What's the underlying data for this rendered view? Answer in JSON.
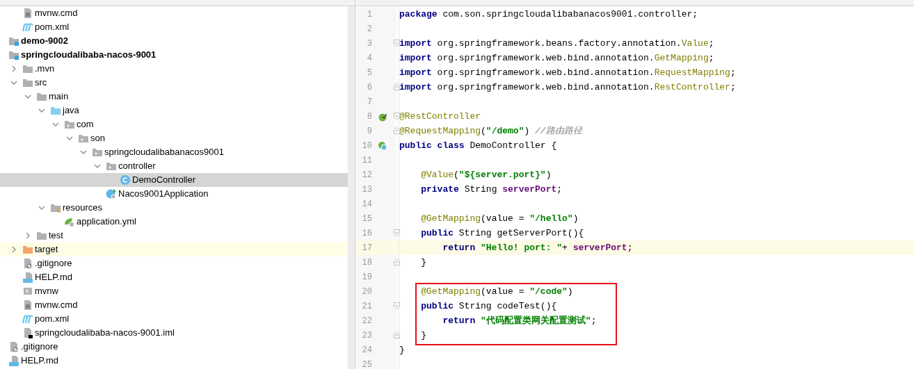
{
  "project_tree": {
    "partial_top": [
      {
        "name": "mvnw.cmd",
        "kind": "text-file"
      },
      {
        "name": "pom.xml",
        "kind": "maven"
      }
    ],
    "items": [
      {
        "name": "demo-9002",
        "kind": "module",
        "bold": true
      },
      {
        "name": "springcloudalibaba-nacos-9001",
        "kind": "module",
        "bold": true,
        "children": [
          {
            "name": ".mvn",
            "kind": "folder",
            "expanded": false
          },
          {
            "name": "src",
            "kind": "folder",
            "expanded": true,
            "children": [
              {
                "name": "main",
                "kind": "folder",
                "expanded": true,
                "children": [
                  {
                    "name": "java",
                    "kind": "source-folder",
                    "expanded": true,
                    "children": [
                      {
                        "name": "com",
                        "kind": "package",
                        "expanded": true,
                        "children": [
                          {
                            "name": "son",
                            "kind": "package",
                            "expanded": true,
                            "children": [
                              {
                                "name": "springcloudalibabanacos9001",
                                "kind": "package",
                                "expanded": true,
                                "children": [
                                  {
                                    "name": "controller",
                                    "kind": "package",
                                    "expanded": true,
                                    "children": [
                                      {
                                        "name": "DemoController",
                                        "kind": "class",
                                        "selected": true
                                      }
                                    ]
                                  },
                                  {
                                    "name": "Nacos9001Application",
                                    "kind": "app-class",
                                    "selected": false
                                  }
                                ]
                              }
                            ]
                          }
                        ]
                      }
                    ]
                  },
                  {
                    "name": "resources",
                    "kind": "resources-folder",
                    "expanded": true,
                    "children": [
                      {
                        "name": "application.yml",
                        "kind": "spring-config"
                      }
                    ]
                  }
                ]
              },
              {
                "name": "test",
                "kind": "folder",
                "expanded": false
              }
            ]
          },
          {
            "name": "target",
            "kind": "excluded-folder",
            "expanded": false,
            "ignored": true
          },
          {
            "name": ".gitignore",
            "kind": "ignore-file"
          },
          {
            "name": "HELP.md",
            "kind": "markdown"
          },
          {
            "name": "mvnw",
            "kind": "script"
          },
          {
            "name": "mvnw.cmd",
            "kind": "text-file"
          },
          {
            "name": "pom.xml",
            "kind": "maven"
          },
          {
            "name": "springcloudalibaba-nacos-9001.iml",
            "kind": "iml"
          }
        ]
      },
      {
        "name": ".gitignore",
        "kind": "ignore-file"
      },
      {
        "name": "HELP.md",
        "kind": "markdown"
      }
    ]
  },
  "editor": {
    "lines": [
      {
        "number": "1",
        "tokens": [
          {
            "kind": "keyword",
            "text": "package"
          },
          {
            "kind": "plain",
            "text": " com.son.springcloudalibabanacos9001.controller;"
          }
        ]
      },
      {
        "number": "2"
      },
      {
        "number": "3",
        "fold": {
          "kind": "open"
        },
        "tokens": [
          {
            "kind": "keyword",
            "text": "import"
          },
          {
            "kind": "plain",
            "text": " org.springframework.beans.factory.annotation."
          },
          {
            "kind": "annotation",
            "text": "Value"
          },
          {
            "kind": "plain",
            "text": ";"
          }
        ]
      },
      {
        "number": "4",
        "tokens": [
          {
            "kind": "keyword",
            "text": "import"
          },
          {
            "kind": "plain",
            "text": " org.springframework.web.bind.annotation."
          },
          {
            "kind": "annotation",
            "text": "GetMapping"
          },
          {
            "kind": "plain",
            "text": ";"
          }
        ]
      },
      {
        "number": "5",
        "tokens": [
          {
            "kind": "keyword",
            "text": "import"
          },
          {
            "kind": "plain",
            "text": " org.springframework.web.bind.annotation."
          },
          {
            "kind": "annotation",
            "text": "RequestMapping"
          },
          {
            "kind": "plain",
            "text": ";"
          }
        ]
      },
      {
        "number": "6",
        "fold": {
          "kind": "close"
        },
        "tokens": [
          {
            "kind": "keyword",
            "text": "import"
          },
          {
            "kind": "plain",
            "text": " org.springframework.web.bind.annotation."
          },
          {
            "kind": "annotation",
            "text": "RestController"
          },
          {
            "kind": "plain",
            "text": ";"
          }
        ]
      },
      {
        "number": "7"
      },
      {
        "number": "8",
        "fold": {
          "kind": "open"
        },
        "gutter": {
          "kind": "bean"
        },
        "tokens": [
          {
            "kind": "annotation",
            "text": "@RestController"
          }
        ]
      },
      {
        "number": "9",
        "fold": {
          "kind": "close"
        },
        "tokens": [
          {
            "kind": "annotation",
            "text": "@RequestMapping"
          },
          {
            "kind": "plain",
            "text": "("
          },
          {
            "kind": "string",
            "text": "\"/demo\""
          },
          {
            "kind": "plain",
            "text": ") "
          },
          {
            "kind": "comment",
            "text": "//路由路径"
          }
        ]
      },
      {
        "number": "10",
        "gutter": {
          "kind": "class"
        },
        "tokens": [
          {
            "kind": "keyword",
            "text": "public class"
          },
          {
            "kind": "plain",
            "text": " DemoController {"
          }
        ]
      },
      {
        "number": "11"
      },
      {
        "number": "12",
        "tokens": [
          {
            "kind": "annotation",
            "text": "    @Value"
          },
          {
            "kind": "plain",
            "text": "("
          },
          {
            "kind": "string",
            "text": "\"${server.port}\""
          },
          {
            "kind": "plain",
            "text": ")"
          }
        ]
      },
      {
        "number": "13",
        "tokens": [
          {
            "kind": "keyword",
            "text": "    private"
          },
          {
            "kind": "plain",
            "text": " String "
          },
          {
            "kind": "field",
            "text": "serverPort"
          },
          {
            "kind": "plain",
            "text": ";"
          }
        ]
      },
      {
        "number": "14"
      },
      {
        "number": "15",
        "tokens": [
          {
            "kind": "annotation",
            "text": "    @GetMapping"
          },
          {
            "kind": "plain",
            "text": "(value = "
          },
          {
            "kind": "string",
            "text": "\"/hello\""
          },
          {
            "kind": "plain",
            "text": ")"
          }
        ]
      },
      {
        "number": "16",
        "fold": {
          "kind": "open"
        },
        "tokens": [
          {
            "kind": "keyword",
            "text": "    public"
          },
          {
            "kind": "plain",
            "text": " String getServerPort(){"
          }
        ]
      },
      {
        "number": "17",
        "current": true,
        "tokens": [
          {
            "kind": "keyword",
            "text": "        return"
          },
          {
            "kind": "string",
            "text": " \"Hello! port: \""
          },
          {
            "kind": "plain",
            "text": "+ "
          },
          {
            "kind": "field",
            "text": "serverPort"
          },
          {
            "kind": "plain",
            "text": ";"
          }
        ]
      },
      {
        "number": "18",
        "fold": {
          "kind": "close"
        },
        "tokens": [
          {
            "kind": "plain",
            "text": "    }"
          }
        ]
      },
      {
        "number": "19"
      },
      {
        "number": "20",
        "boxed": true,
        "tokens": [
          {
            "kind": "annotation",
            "text": "    @GetMapping"
          },
          {
            "kind": "plain",
            "text": "(value = "
          },
          {
            "kind": "string",
            "text": "\"/code\""
          },
          {
            "kind": "plain",
            "text": ")"
          }
        ]
      },
      {
        "number": "21",
        "boxed": true,
        "fold": {
          "kind": "open"
        },
        "tokens": [
          {
            "kind": "keyword",
            "text": "    public"
          },
          {
            "kind": "plain",
            "text": " String codeTest(){"
          }
        ]
      },
      {
        "number": "22",
        "boxed": true,
        "tokens": [
          {
            "kind": "keyword",
            "text": "        return"
          },
          {
            "kind": "string",
            "text": " \"代码配置类网关配置测试\""
          },
          {
            "kind": "plain",
            "text": ";"
          }
        ]
      },
      {
        "number": "23",
        "boxed": true,
        "fold": {
          "kind": "close"
        },
        "tokens": [
          {
            "kind": "plain",
            "text": "    }"
          }
        ]
      },
      {
        "number": "24",
        "tokens": [
          {
            "kind": "plain",
            "text": "}"
          }
        ]
      },
      {
        "number": "25"
      }
    ]
  }
}
